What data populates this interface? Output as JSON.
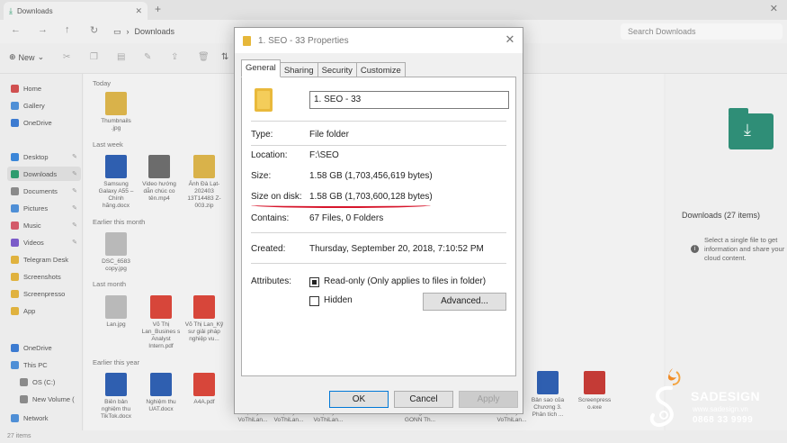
{
  "explorer": {
    "tab_title": "Downloads",
    "address": "Downloads",
    "search_placeholder": "Search Downloads",
    "new_label": "New",
    "status": "27 items",
    "sidebar": [
      {
        "label": "Home",
        "color": "#d05050"
      },
      {
        "label": "Gallery",
        "color": "#4f8fd6"
      },
      {
        "label": "OneDrive",
        "color": "#3c7bd1"
      },
      {
        "label": "Desktop",
        "color": "#3b86d8"
      },
      {
        "label": "Downloads",
        "color": "#2f9c6f"
      },
      {
        "label": "Documents",
        "color": "#8a8a8a"
      },
      {
        "label": "Pictures",
        "color": "#4f8fd6"
      },
      {
        "label": "Music",
        "color": "#d35a6a"
      },
      {
        "label": "Videos",
        "color": "#7b5bc9"
      },
      {
        "label": "Telegram Desk",
        "color": "#e0b23e"
      },
      {
        "label": "Screenshots",
        "color": "#e0b23e"
      },
      {
        "label": "Screenpresso",
        "color": "#e0b23e"
      },
      {
        "label": "App",
        "color": "#e0b23e"
      },
      {
        "label": "OneDrive",
        "color": "#3c7bd1"
      },
      {
        "label": "This PC",
        "color": "#4f8fd6"
      },
      {
        "label": "OS (C:)",
        "color": "#8a8a8a"
      },
      {
        "label": "New Volume (",
        "color": "#8a8a8a"
      },
      {
        "label": "Network",
        "color": "#4f8fd6"
      }
    ],
    "groups": [
      "Today",
      "Last week",
      "Earlier this month",
      "Last month",
      "Earlier this year"
    ],
    "files": [
      {
        "name": "Thumbnails .jpg",
        "kind": "t-fold"
      },
      {
        "name": "Samsung Galaxy A55 – Chính hãng.docx",
        "kind": "t-word"
      },
      {
        "name": "Video hướng dẫn chúc co tên.mp4",
        "kind": "t-vid"
      },
      {
        "name": "Ảnh Đà Lạt-202403 13T14483 Z-003.zip",
        "kind": "t-fold"
      },
      {
        "name": "DSC_6583 copy.jpg",
        "kind": "t-img"
      },
      {
        "name": "Lan.jpg",
        "kind": "t-img"
      },
      {
        "name": "Võ Thị Lan_Busines s Analyst Intern.pdf",
        "kind": "t-pdf"
      },
      {
        "name": "Võ Thị Lan_Kỹ sư giải pháp nghiệp vu...",
        "kind": "t-pdf"
      },
      {
        "name": "Biên bản nghiệm thu TikTok.docx",
        "kind": "t-word"
      },
      {
        "name": "Nghiệm thu UAT.docx",
        "kind": "t-word"
      },
      {
        "name": "A4A.pdf",
        "kind": "t-pdf"
      },
      {
        "name": "Đợt 2) – VoThiLan...",
        "kind": "t-img"
      },
      {
        "name": "Đợt 2) – VoThiLan...",
        "kind": "t-img"
      },
      {
        "name": "Đợt 2) – VoThiLan...",
        "kind": "t-img"
      },
      {
        "name": "Trung tâm GONN Th...",
        "kind": "t-img"
      },
      {
        "name": "Đợt 2) – VoThiLan...",
        "kind": "t-img"
      },
      {
        "name": "Bản sao của Chương 3. Phân tích ...",
        "kind": "t-word"
      },
      {
        "name": "Screenpress o.exe",
        "kind": "t-red"
      }
    ],
    "details_title": "Downloads (27 items)",
    "details_text": "Select a single file to get information and share your cloud content."
  },
  "dialog": {
    "title": "1. SEO - 33 Properties",
    "tabs": [
      "General",
      "Sharing",
      "Security",
      "Customize"
    ],
    "name_value": "1. SEO - 33",
    "type_label": "Type:",
    "type_value": "File folder",
    "location_label": "Location:",
    "location_value": "F:\\SEO",
    "size_label": "Size:",
    "size_value": "1.58 GB (1,703,456,619 bytes)",
    "size_on_disk_label": "Size on disk:",
    "size_on_disk_value": "1.58 GB (1,703,600,128 bytes)",
    "contains_label": "Contains:",
    "contains_value": "67 Files, 0 Folders",
    "created_label": "Created:",
    "created_value": "Thursday, September 20, 2018, 7:10:52 PM",
    "attributes_label": "Attributes:",
    "readonly_label": "Read-only (Only applies to files in folder)",
    "readonly_checked": true,
    "hidden_label": "Hidden",
    "hidden_checked": false,
    "advanced_label": "Advanced...",
    "ok_label": "OK",
    "cancel_label": "Cancel",
    "apply_label": "Apply"
  },
  "watermark": {
    "brand": "SADESIGN",
    "website": "www.sadesign.vn",
    "phone": "0868 33 9999"
  }
}
